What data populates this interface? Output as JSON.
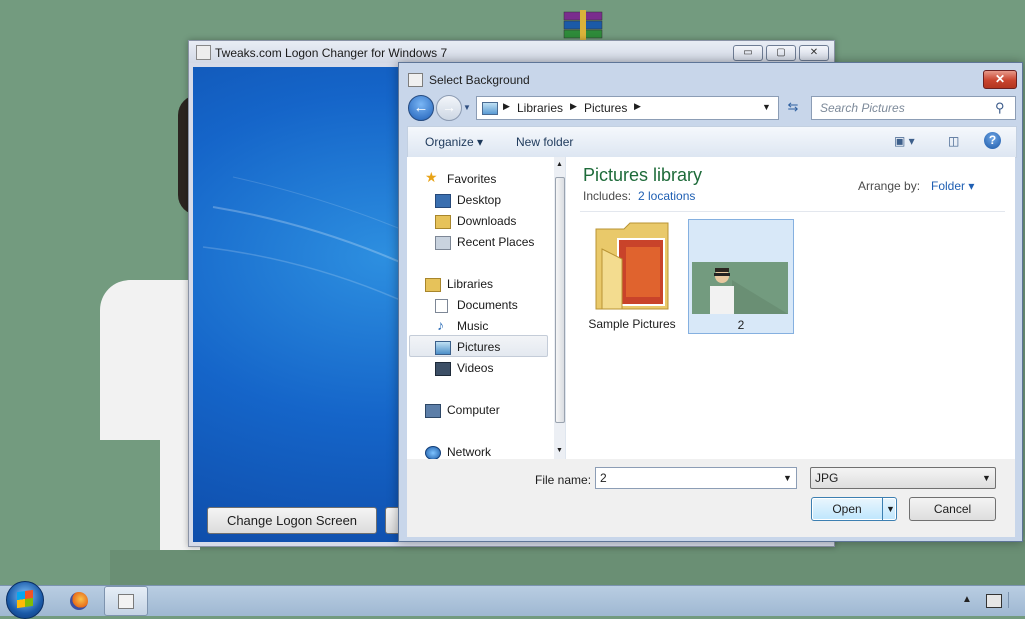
{
  "desktop": {
    "icons": [
      "winrar-icon"
    ]
  },
  "background_window": {
    "title": "Tweaks.com Logon Changer for Windows 7",
    "minimize": "▭",
    "maximize": "▢",
    "close": "✕",
    "change_button": "Change Logon Screen"
  },
  "dialog": {
    "title": "Select Background",
    "close": "✕",
    "breadcrumb": [
      "Libraries",
      "Pictures"
    ],
    "search_placeholder": "Search Pictures",
    "toolbar": {
      "organize": "Organize",
      "new_folder": "New folder"
    },
    "nav": {
      "favorites": "Favorites",
      "desktop": "Desktop",
      "downloads": "Downloads",
      "recent_places": "Recent Places",
      "libraries": "Libraries",
      "documents": "Documents",
      "music": "Music",
      "pictures": "Pictures",
      "videos": "Videos",
      "computer": "Computer",
      "network": "Network"
    },
    "content": {
      "title": "Pictures library",
      "includes_label": "Includes:",
      "includes_link": "2 locations",
      "arrange_label": "Arrange by:",
      "arrange_value": "Folder",
      "items": [
        "Sample Pictures",
        "2"
      ]
    },
    "file_name_label": "File name:",
    "file_name_value": "2",
    "file_type_value": "JPG",
    "open_button": "Open",
    "cancel_button": "Cancel"
  },
  "colors": {
    "desktop": "#739b7f",
    "library_title": "#1e6b3a",
    "link": "#1f5fb3"
  }
}
